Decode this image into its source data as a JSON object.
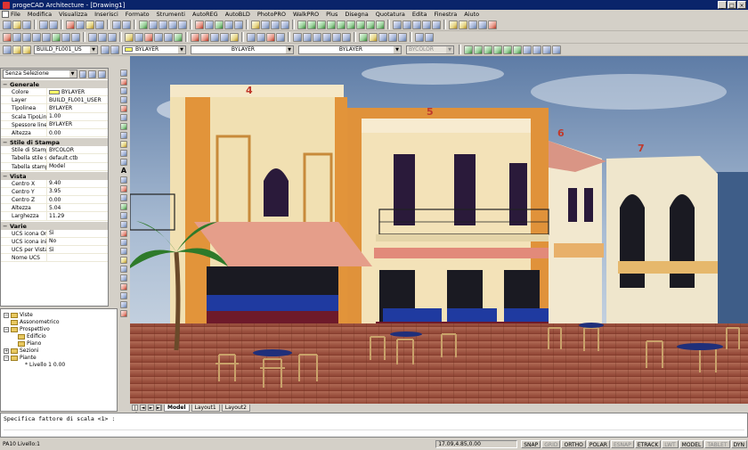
{
  "window": {
    "title": "progeCAD Architecture - [Drawing1]",
    "buttons": [
      "_",
      "□",
      "×"
    ]
  },
  "menu": [
    "File",
    "Modifica",
    "Visualizza",
    "Inserisci",
    "Formato",
    "Strumenti",
    "AutoREG",
    "AutoBLD",
    "PhotoPRO",
    "WalkPRO",
    "Plus",
    "Disegna",
    "Quotatura",
    "Edita",
    "Finestra",
    "Aiuto"
  ],
  "layer_bar": {
    "layer": "BUILD_FL001_US",
    "color": "BYLAYER",
    "linetype": "BYLAYER",
    "lineweight": "BYLAYER",
    "plotstyle": "BYCOLOR"
  },
  "properties": {
    "selection": "Senza Selezione",
    "sections": [
      {
        "title": "Generale",
        "rows": [
          {
            "k": "Colore",
            "v": "BYLAYER",
            "swatch": true
          },
          {
            "k": "Layer",
            "v": "BUILD_FL001_USER"
          },
          {
            "k": "Tipolinea",
            "v": "BYLAYER"
          },
          {
            "k": "Scala TipoLinea",
            "v": "1.00"
          },
          {
            "k": "Spessore linea",
            "v": "BYLAYER"
          },
          {
            "k": "Altezza",
            "v": "0.00"
          }
        ]
      },
      {
        "title": "Stile di Stampa",
        "rows": [
          {
            "k": "Stile di Stampa",
            "v": "BYCOLOR"
          },
          {
            "k": "Tabella stile stampa",
            "v": "default.ctb"
          },
          {
            "k": "Tabella stampa coll...",
            "v": "Model"
          }
        ]
      },
      {
        "title": "Vista",
        "rows": [
          {
            "k": "Centro X",
            "v": "9.40"
          },
          {
            "k": "Centro Y",
            "v": "3.95"
          },
          {
            "k": "Centro Z",
            "v": "0.00"
          },
          {
            "k": "Altezza",
            "v": "5.04"
          },
          {
            "k": "Larghezza",
            "v": "11.29"
          }
        ]
      },
      {
        "title": "Varie",
        "rows": [
          {
            "k": "UCS icona On",
            "v": "Sì"
          },
          {
            "k": "UCS icona iniziale",
            "v": "No"
          },
          {
            "k": "UCS per Vista",
            "v": "Sì"
          },
          {
            "k": "Nome UCS",
            "v": ""
          }
        ]
      }
    ]
  },
  "tree": [
    "Viste",
    "Assonometrico",
    "Prospettivo",
    "Edificio",
    "Piano",
    "Sezioni",
    "Piante",
    "Livello 1  0.00"
  ],
  "scene_labels": [
    "4",
    "5",
    "6",
    "7"
  ],
  "tabs": [
    "Model",
    "Layout1",
    "Layout2"
  ],
  "command": {
    "prompt": "Specifica fattore di scala <1> :",
    "input": ""
  },
  "status": {
    "left": "PA10 Livello:1",
    "coords": "17.09,4.85,0.00",
    "toggles": [
      {
        "label": "SNAP",
        "on": true
      },
      {
        "label": "GRID",
        "on": false
      },
      {
        "label": "ORTHO",
        "on": true
      },
      {
        "label": "POLAR",
        "on": true
      },
      {
        "label": "ESNAP",
        "on": false
      },
      {
        "label": "ETRACK",
        "on": true
      },
      {
        "label": "LWT",
        "on": false
      },
      {
        "label": "MODEL",
        "on": true
      },
      {
        "label": "TABLET",
        "on": false
      },
      {
        "label": "DYN",
        "on": true
      }
    ]
  }
}
